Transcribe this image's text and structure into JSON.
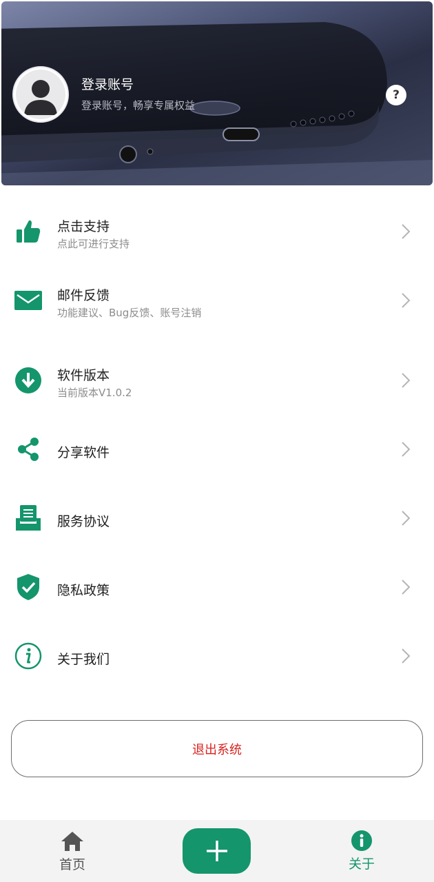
{
  "header": {
    "login_title": "登录账号",
    "login_subtitle": "登录账号，畅享专属权益",
    "help_label": "?"
  },
  "menu": [
    {
      "icon": "thumbs-up-icon",
      "title": "点击支持",
      "subtitle": "点此可进行支持"
    },
    {
      "icon": "mail-icon",
      "title": "邮件反馈",
      "subtitle": "功能建议、Bug反馈、账号注销"
    },
    {
      "icon": "download-icon",
      "title": "软件版本",
      "subtitle": "当前版本V1.0.2"
    },
    {
      "icon": "share-icon",
      "title": "分享软件",
      "subtitle": ""
    },
    {
      "icon": "document-icon",
      "title": "服务协议",
      "subtitle": ""
    },
    {
      "icon": "shield-check-icon",
      "title": "隐私政策",
      "subtitle": ""
    },
    {
      "icon": "info-icon",
      "title": "关于我们",
      "subtitle": ""
    }
  ],
  "logout_label": "退出系统",
  "bottom_nav": {
    "home_label": "首页",
    "about_label": "关于",
    "active": "about"
  },
  "colors": {
    "accent": "#14956b",
    "danger": "#d9231e",
    "inactive": "#555555"
  }
}
